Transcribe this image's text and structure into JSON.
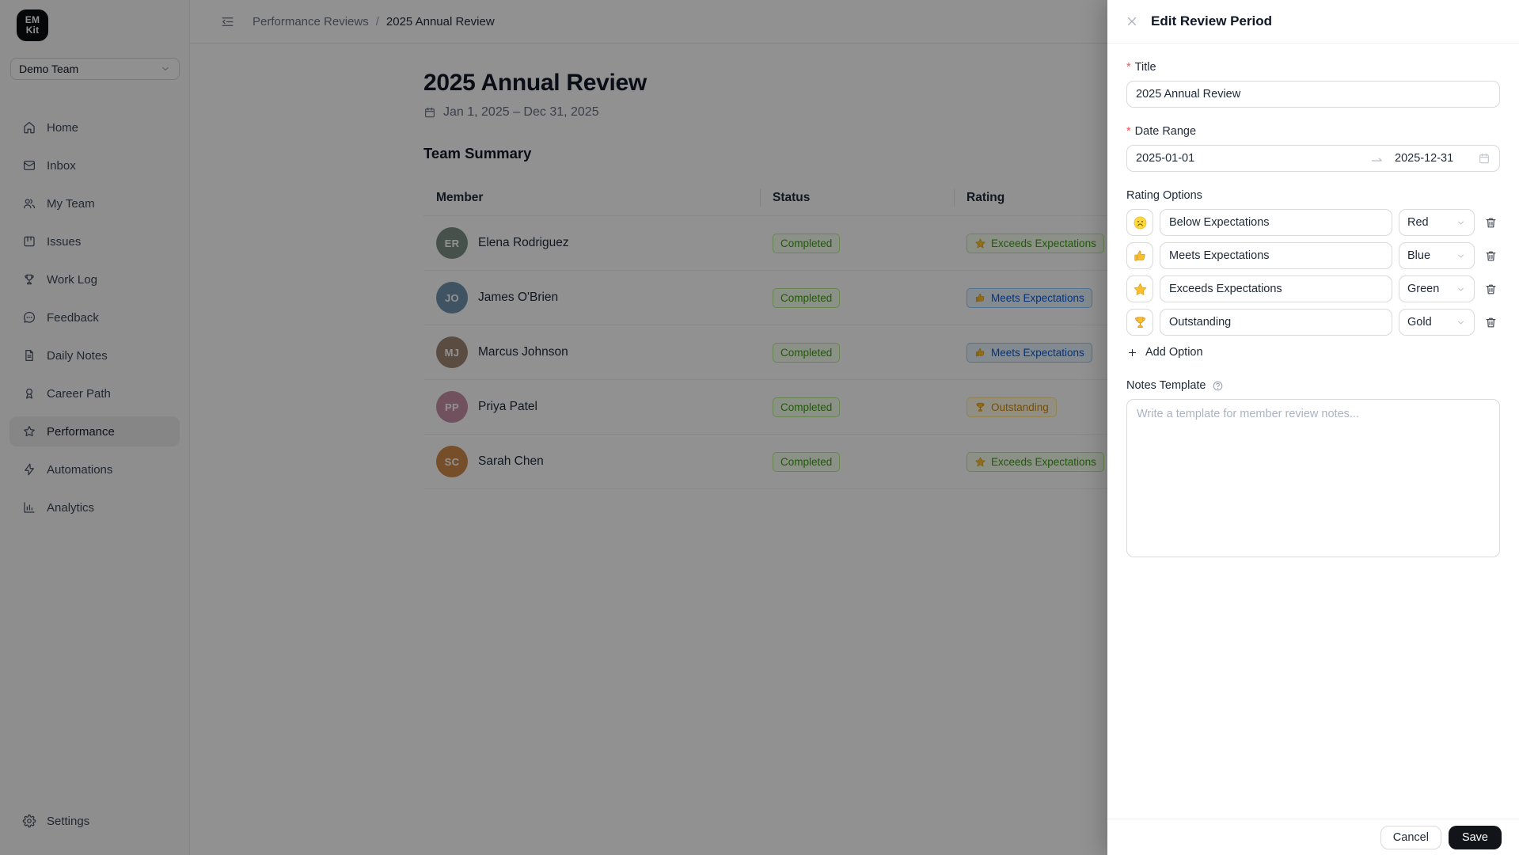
{
  "brand": {
    "logo_line1": "EM",
    "logo_line2": "Kit"
  },
  "team_selector": {
    "value": "Demo Team"
  },
  "sidebar": {
    "items": [
      {
        "label": "Home",
        "icon": "home"
      },
      {
        "label": "Inbox",
        "icon": "mail"
      },
      {
        "label": "My Team",
        "icon": "users"
      },
      {
        "label": "Issues",
        "icon": "kanban"
      },
      {
        "label": "Work Log",
        "icon": "trophy-outline"
      },
      {
        "label": "Feedback",
        "icon": "chat"
      },
      {
        "label": "Daily Notes",
        "icon": "document"
      },
      {
        "label": "Career Path",
        "icon": "medal"
      },
      {
        "label": "Performance",
        "icon": "star-outline",
        "active": "true"
      },
      {
        "label": "Automations",
        "icon": "bolt"
      },
      {
        "label": "Analytics",
        "icon": "chart"
      }
    ],
    "settings": {
      "label": "Settings",
      "icon": "gear"
    }
  },
  "header": {
    "breadcrumb": {
      "parent": "Performance Reviews",
      "separator": "/",
      "current": "2025 Annual Review"
    }
  },
  "page": {
    "title": "2025 Annual Review",
    "date_range": "Jan 1, 2025 – Dec 31, 2025",
    "section_title": "Team Summary"
  },
  "table": {
    "columns": {
      "member": "Member",
      "status": "Status",
      "rating": "Rating"
    },
    "rows": [
      {
        "member": "Elena Rodriguez",
        "initials": "ER",
        "avatar_color": "#7d8f86",
        "status": "Completed",
        "status_color": "green",
        "rating": {
          "label": "Exceeds Expectations",
          "icon": "star",
          "color": "green"
        }
      },
      {
        "member": "James O'Brien",
        "initials": "JO",
        "avatar_color": "#6f93ad",
        "status": "Completed",
        "status_color": "green",
        "rating": {
          "label": "Meets Expectations",
          "icon": "thumbs-up",
          "color": "blue"
        }
      },
      {
        "member": "Marcus Johnson",
        "initials": "MJ",
        "avatar_color": "#a18672",
        "status": "Completed",
        "status_color": "green",
        "rating": {
          "label": "Meets Expectations",
          "icon": "thumbs-up",
          "color": "blue"
        }
      },
      {
        "member": "Priya Patel",
        "initials": "PP",
        "avatar_color": "#c98fa6",
        "status": "Completed",
        "status_color": "green",
        "rating": {
          "label": "Outstanding",
          "icon": "trophy",
          "color": "gold"
        }
      },
      {
        "member": "Sarah Chen",
        "initials": "SC",
        "avatar_color": "#d08a4b",
        "status": "Completed",
        "status_color": "green",
        "rating": {
          "label": "Exceeds Expectations",
          "icon": "star",
          "color": "green"
        }
      }
    ]
  },
  "drawer": {
    "title": "Edit Review Period",
    "required_mark": "*",
    "title_field": {
      "label": "Title",
      "value": "2025 Annual Review"
    },
    "date_field": {
      "label": "Date Range",
      "start": "2025-01-01",
      "end": "2025-12-31"
    },
    "rating_options": {
      "label": "Rating Options",
      "add_label": "Add Option",
      "options": [
        {
          "icon": "worried-face",
          "name": "Below Expectations",
          "color": "Red"
        },
        {
          "icon": "thumbs-up",
          "name": "Meets Expectations",
          "color": "Blue"
        },
        {
          "icon": "star",
          "name": "Exceeds Expectations",
          "color": "Green"
        },
        {
          "icon": "trophy",
          "name": "Outstanding",
          "color": "Gold"
        }
      ]
    },
    "notes_field": {
      "label": "Notes Template",
      "placeholder": "Write a template for member review notes..."
    },
    "footer": {
      "cancel_label": "Cancel",
      "save_label": "Save"
    }
  },
  "colors": {
    "tag_green_text": "#389e0d",
    "tag_green_bg": "#f6ffed",
    "tag_blue_text": "#0958d9",
    "tag_blue_bg": "#e6f4ff",
    "tag_gold_text": "#d48806",
    "tag_gold_bg": "#fffbe6",
    "required_mark": "#ff4d4f",
    "save_button_bg": "#111418",
    "sidebar_bg": "#fafafa",
    "active_item_bg": "#ececee"
  }
}
